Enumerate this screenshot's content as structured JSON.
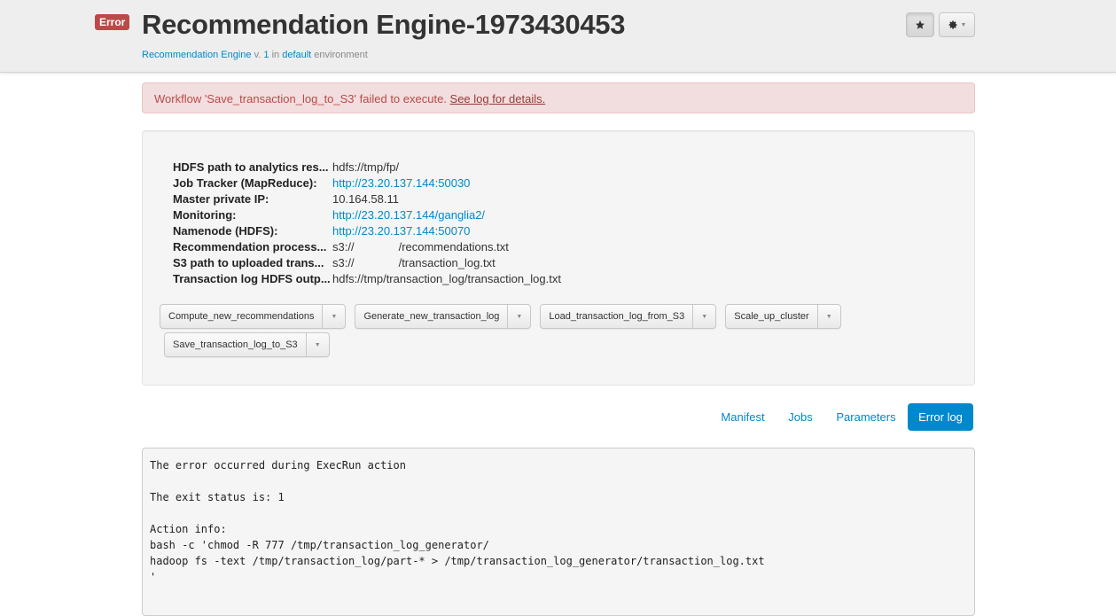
{
  "header": {
    "status_badge": "Error",
    "title": "Recommendation Engine-1973430453",
    "subtitle": {
      "app_link": "Recommendation Engine",
      "version_prefix": " v. ",
      "version": "1",
      "env_prefix": " in ",
      "env_link": "default",
      "env_suffix": " environment"
    },
    "star_icon": "star-icon",
    "gear_icon": "gear-icon"
  },
  "alert": {
    "message": "Workflow 'Save_transaction_log_to_S3' failed to execute. ",
    "link": "See log for details."
  },
  "properties": [
    {
      "key": "HDFS path to analytics res...",
      "value": "hdfs://tmp/fp/",
      "link": false
    },
    {
      "key": "Job Tracker (MapReduce):",
      "value": "http://23.20.137.144:50030",
      "link": true
    },
    {
      "key": "Master private IP:",
      "value": "10.164.58.11",
      "link": false
    },
    {
      "key": "Monitoring:",
      "value": "http://23.20.137.144/ganglia2/",
      "link": true
    },
    {
      "key": "Namenode (HDFS):",
      "value": "http://23.20.137.144:50070",
      "link": true
    },
    {
      "key": "Recommendation process...",
      "value_a": "s3://",
      "value_b": "/recommendations.txt",
      "split": true
    },
    {
      "key": "S3 path to uploaded trans...",
      "value_a": "s3://",
      "value_b": "/transaction_log.txt",
      "split": true
    },
    {
      "key": "Transaction log HDFS outp...",
      "value": "hdfs://tmp/transaction_log/transaction_log.txt",
      "link": false
    }
  ],
  "workflows": [
    "Compute_new_recommendations",
    "Generate_new_transaction_log",
    "Load_transaction_log_from_S3",
    "Scale_up_cluster",
    "Save_transaction_log_to_S3"
  ],
  "tabs": [
    {
      "label": "Manifest",
      "active": false
    },
    {
      "label": "Jobs",
      "active": false
    },
    {
      "label": "Parameters",
      "active": false
    },
    {
      "label": "Error log",
      "active": true
    }
  ],
  "log_lines": [
    "The error occurred during ExecRun action",
    "",
    "The exit status is: 1",
    "",
    "Action info:",
    "bash -c 'chmod -R 777 /tmp/transaction_log_generator/",
    "hadoop fs -text /tmp/transaction_log/part-* > /tmp/transaction_log_generator/transaction_log.txt",
    "'"
  ],
  "colors": {
    "link": "#0088cc",
    "error": "#b94a48",
    "alert_bg": "#f2dede"
  }
}
